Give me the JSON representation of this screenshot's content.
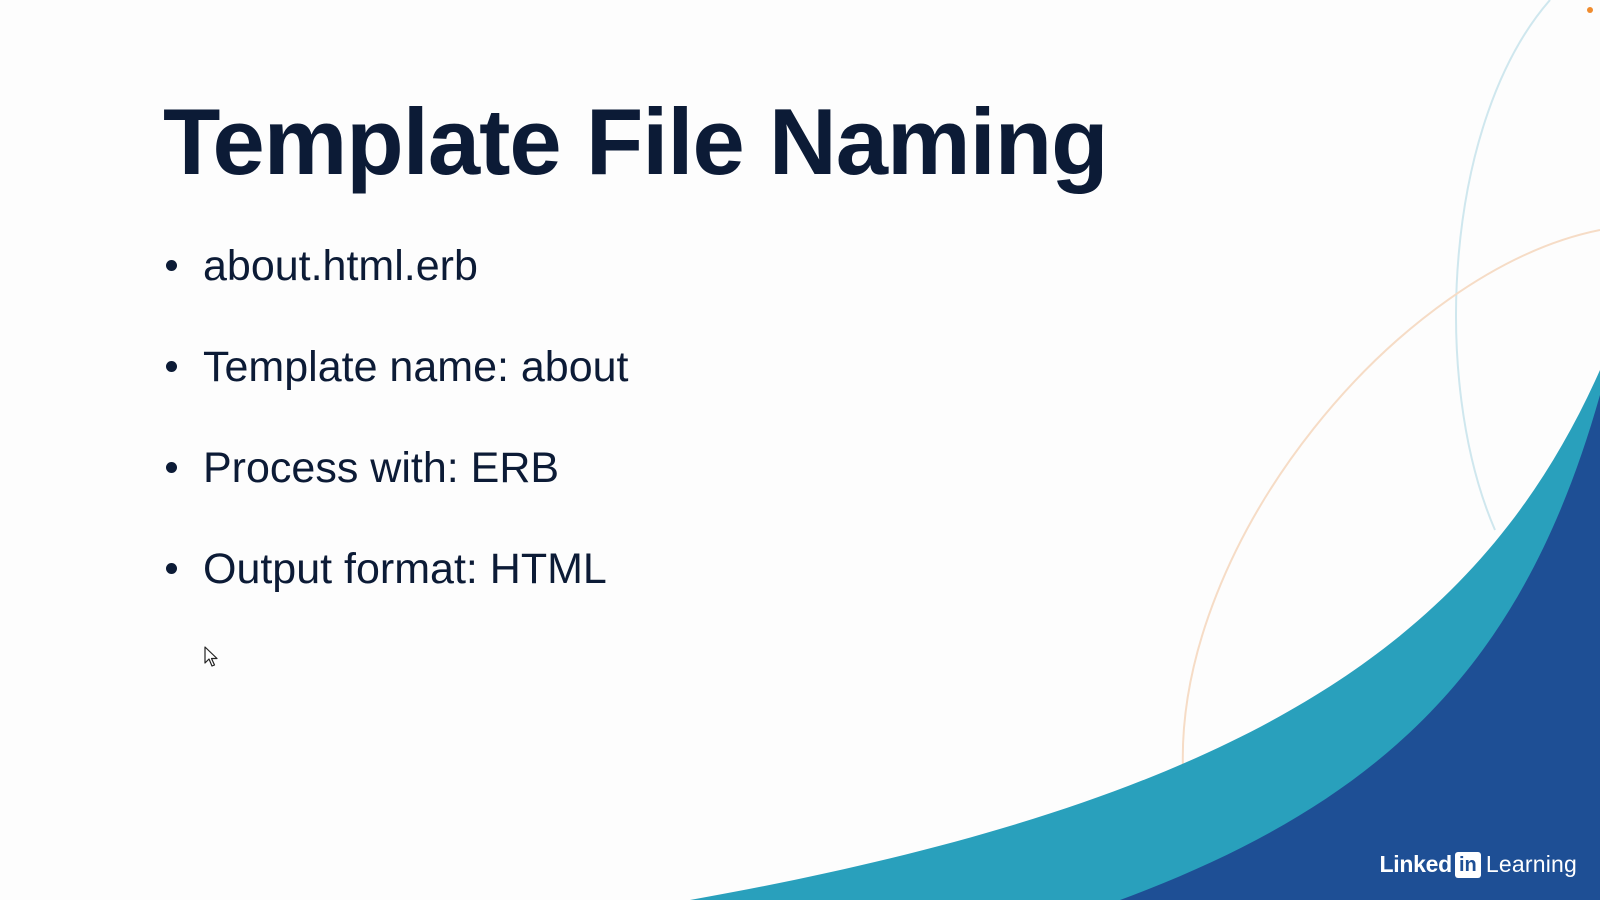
{
  "slide": {
    "title": "Template File Naming",
    "bullets": [
      "about.html.erb",
      "Template name: about",
      "Process with: ERB",
      "Output format: HTML"
    ]
  },
  "branding": {
    "name_part1": "Linked",
    "name_badge": "in",
    "name_part2": "Learning"
  },
  "colors": {
    "background": "#fdfdfd",
    "text": "#0c1b36",
    "teal_wave": "#29a0bc",
    "blue_wave": "#1e4f95",
    "thin_arc_teal": "#cfe7ee",
    "thin_arc_peach": "#f6dcc6",
    "corner_dot": "#f08c2e"
  },
  "icons": [
    "mouse-cursor-icon",
    "linkedin-logo-icon"
  ]
}
